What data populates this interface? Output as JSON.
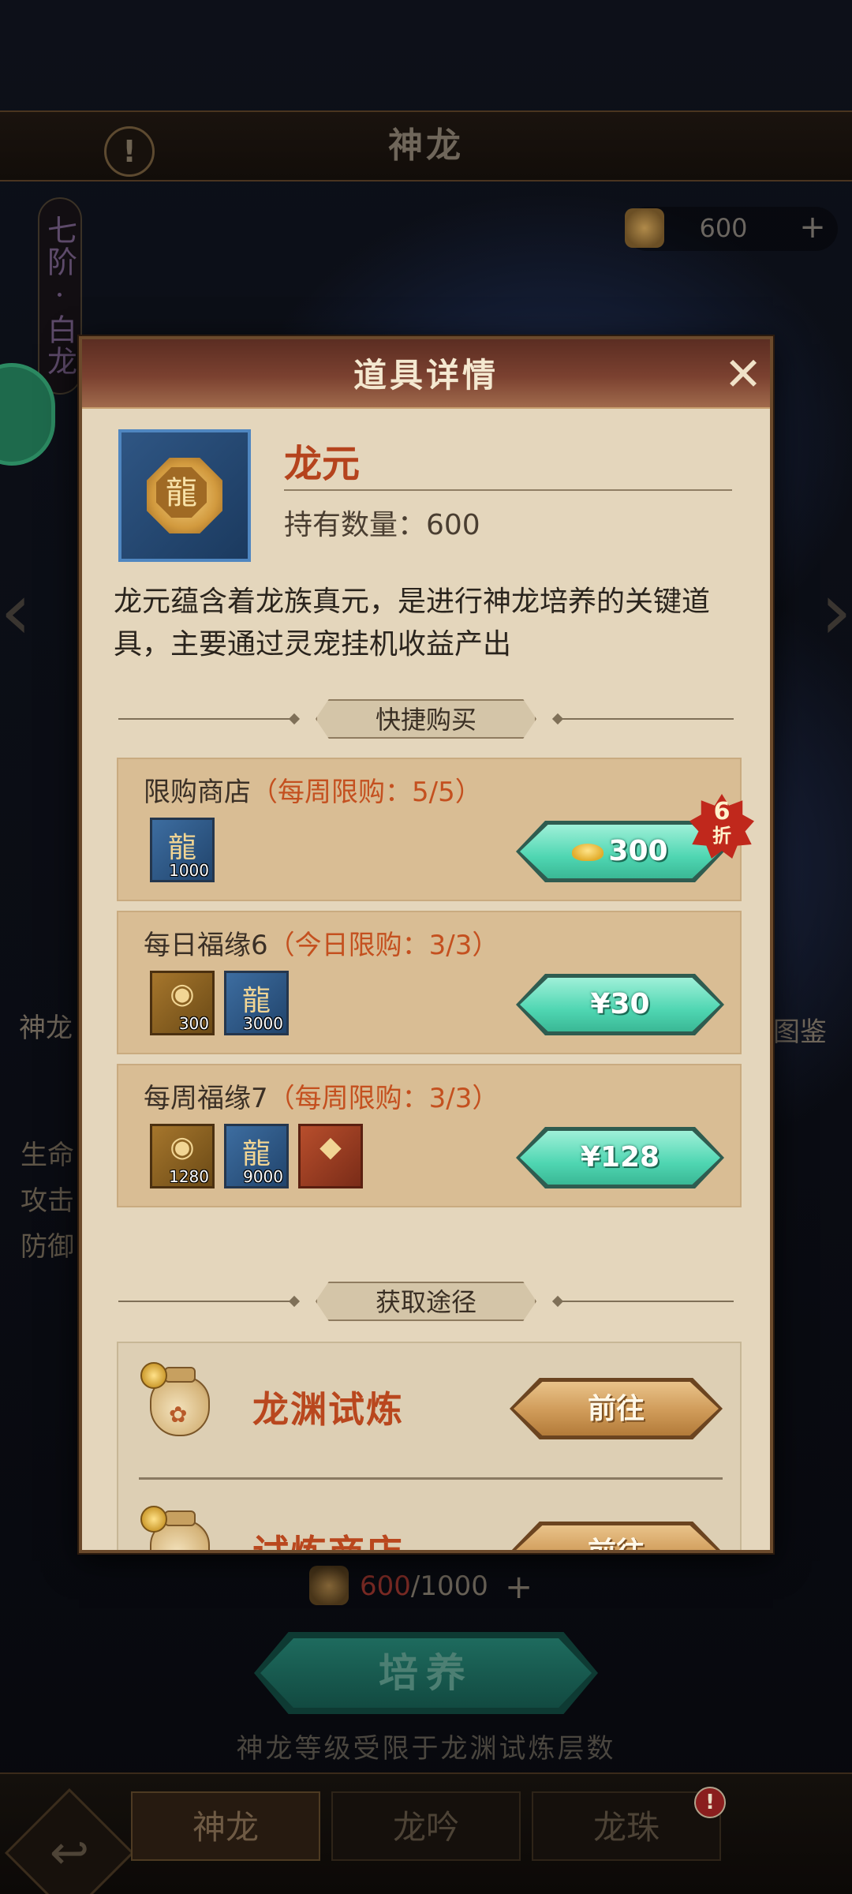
{
  "background": {
    "screen_title": "神龙",
    "currency_top_value": "600",
    "rank_tag": "七阶·白龙",
    "left_label": "神龙",
    "right_label": "图鉴",
    "stats": [
      "生命",
      "攻击",
      "防御"
    ],
    "bottom_counter": {
      "current": "600",
      "max": "/1000"
    },
    "train_button": "培养",
    "train_note": "神龙等级受限于龙渊试炼层数",
    "tabs": [
      "神龙",
      "龙吟",
      "龙珠"
    ],
    "alert_badge": "!"
  },
  "dialog": {
    "title": "道具详情",
    "close_icon": "close-icon",
    "item": {
      "name": "龙元",
      "quantity_label": "持有数量：600",
      "description": "龙元蕴含着龙族真元，是进行神龙培养的关键道具，主要通过灵宠挂机收益产出"
    },
    "quick_buy_label": "快捷购买",
    "shops": [
      {
        "title": "限购商店",
        "limit": "（每周限购：5/5）",
        "items": [
          {
            "type": "dragon-essence",
            "count": "1000"
          }
        ],
        "price": "300",
        "price_icon": "gold-ingot-icon",
        "discount_number": "6",
        "discount_text": "折"
      },
      {
        "title": "每日福缘6",
        "limit": "（今日限购：3/3）",
        "items": [
          {
            "type": "gold-ingot",
            "count": "300"
          },
          {
            "type": "dragon-essence",
            "count": "3000"
          }
        ],
        "price": "¥30"
      },
      {
        "title": "每周福缘7",
        "limit": "（每周限购：3/3）",
        "items": [
          {
            "type": "gold-ingot",
            "count": "1280"
          },
          {
            "type": "dragon-essence",
            "count": "9000"
          },
          {
            "type": "red-crystal",
            "count": ""
          }
        ],
        "price": "¥128"
      }
    ],
    "sources_label": "获取途径",
    "sources": [
      {
        "name": "龙渊试炼",
        "button": "前往"
      },
      {
        "name": "试炼商店",
        "button": "前往"
      }
    ]
  }
}
